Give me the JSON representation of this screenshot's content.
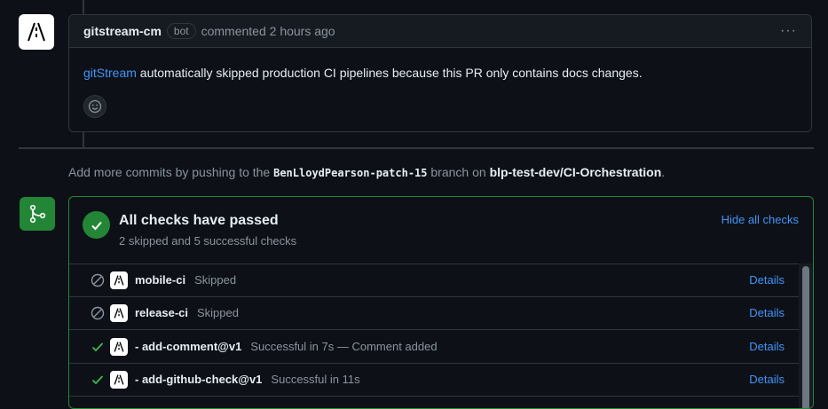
{
  "comment": {
    "author": "gitstream-cm",
    "badge": "bot",
    "meta": "commented 2 hours ago",
    "menu_glyph": "···",
    "body_link": "gitStream",
    "body_text": " automatically skipped production CI pipelines because this PR only contains docs changes.",
    "avatar_icon": "gitstream-logo-icon",
    "reaction_icon": "smiley-icon"
  },
  "push_hint": {
    "prefix": "Add more commits by pushing to the ",
    "branch": "BenLloydPearson-patch-15",
    "middle": " branch on ",
    "repo": "blp-test-dev/CI-Orchestration",
    "suffix": "."
  },
  "checks": {
    "title": "All checks have passed",
    "subtitle": "2 skipped and 5 successful checks",
    "hide_link": "Hide all checks",
    "accent_color": "#238636",
    "rows": [
      {
        "status": "skipped",
        "name": "mobile-ci",
        "description": "Skipped",
        "details": "Details"
      },
      {
        "status": "skipped",
        "name": "release-ci",
        "description": "Skipped",
        "details": "Details"
      },
      {
        "status": "success",
        "name": "- add-comment@v1",
        "description": "Successful in 7s — Comment added",
        "details": "Details"
      },
      {
        "status": "success",
        "name": "- add-github-check@v1",
        "description": "Successful in 11s",
        "details": "Details"
      }
    ]
  },
  "colors": {
    "link": "#4493f8",
    "success": "#3fb950",
    "muted": "#8b949e",
    "background": "#0d1117"
  }
}
